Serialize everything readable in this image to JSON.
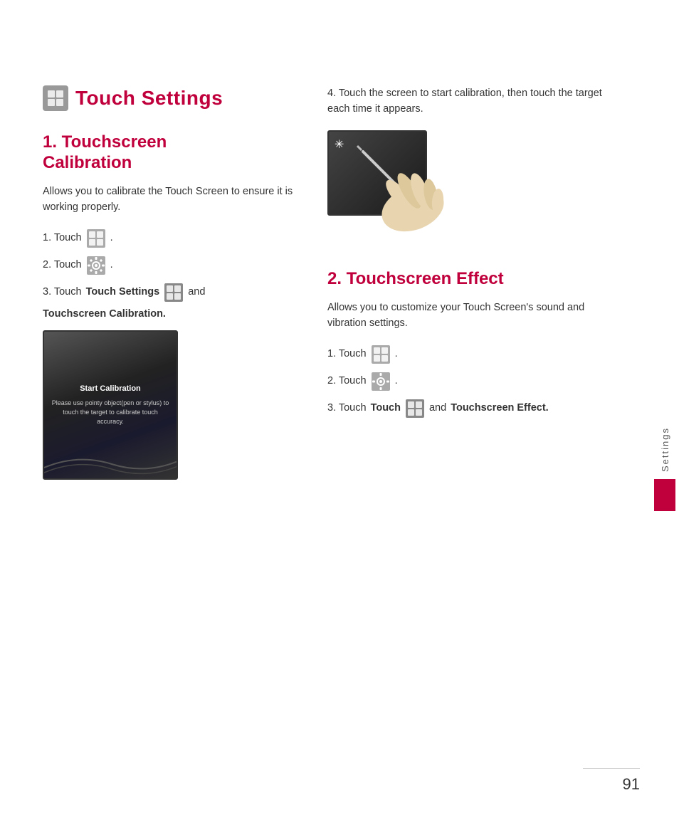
{
  "page": {
    "number": "91",
    "sidebar_label": "Settings"
  },
  "page_title": {
    "text": "Touch Settings",
    "icon_name": "touch-settings-icon"
  },
  "section1": {
    "heading": "1. Touchscreen\n   Calibration",
    "heading_line1": "1. Touchscreen",
    "heading_line2": "   Calibration",
    "description": "Allows you to calibrate the Touch Screen to ensure it is working properly.",
    "step1": "1. Touch",
    "step1_suffix": ".",
    "step2": "2. Touch",
    "step2_suffix": ".",
    "step3_prefix": "3. Touch",
    "step3_bold": "Touch Settings",
    "step3_mid": "",
    "step3_suffix": "and",
    "step3_bold2": "Touchscreen Calibration.",
    "calibration_screen": {
      "title": "Start Calibration",
      "text": "Please use pointy object(pen or stylus) to touch the target to calibrate touch accuracy."
    }
  },
  "section2": {
    "heading": "2. Touchscreen Effect",
    "description": "Allows you to customize your Touch Screen's sound and vibration settings.",
    "step1": "1. Touch",
    "step1_suffix": ".",
    "step2": "2. Touch",
    "step2_suffix": ".",
    "step3_prefix": "3. Touch",
    "step3_bold": "Touch",
    "step3_suffix": "and",
    "step3_bold2": "Touchscreen Effect.",
    "step4": "4. Touch the screen to start calibration, then touch the target each time it appears."
  }
}
